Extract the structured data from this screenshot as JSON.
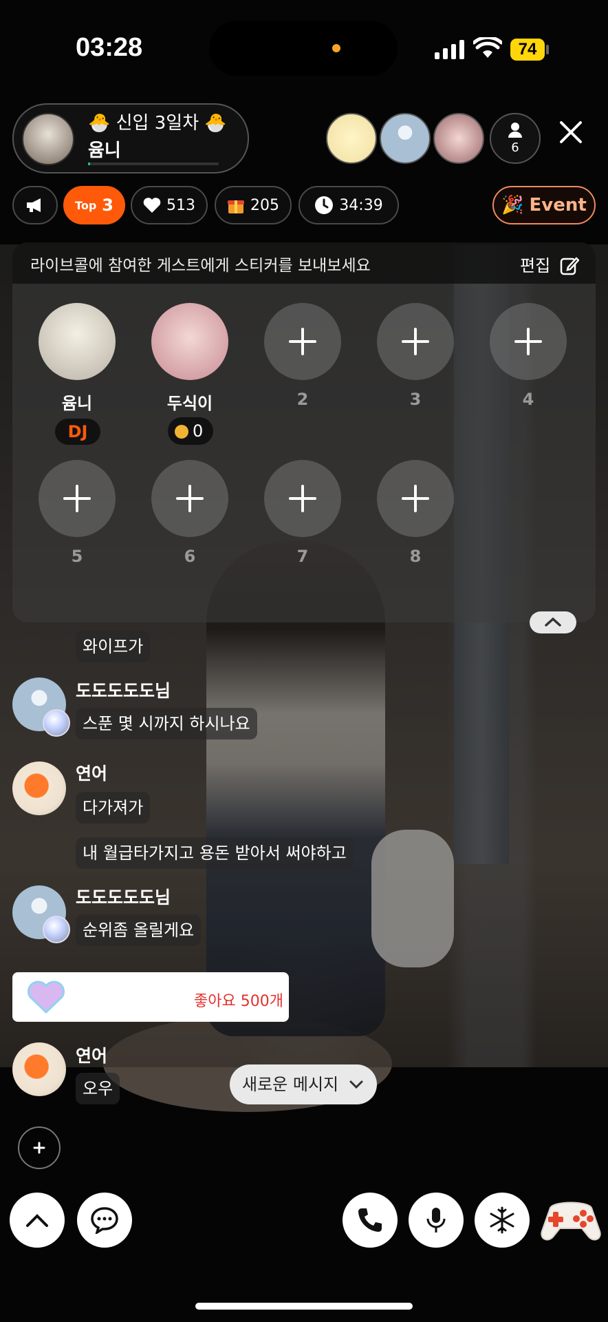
{
  "status_bar": {
    "time": "03:28",
    "battery": "74"
  },
  "host": {
    "title": "신입 3일차",
    "name": "윰니"
  },
  "viewers": {
    "count": "6"
  },
  "chips": {
    "top_label": "Top",
    "top_rank": "3",
    "likes": "513",
    "gifts": "205",
    "timer": "34:39",
    "event": "Event"
  },
  "guest_panel": {
    "message": "라이브콜에 참여한 게스트에게 스티커를 보내보세요",
    "edit": "편집",
    "host_name": "윰니",
    "host_badge": "DJ",
    "guest_name": "두식이",
    "guest_coins": "0",
    "slots": [
      "2",
      "3",
      "4",
      "5",
      "6",
      "7",
      "8"
    ]
  },
  "chat": [
    {
      "user": "",
      "messages": [
        "와이프가"
      ]
    },
    {
      "user": "도도도도도님",
      "messages": [
        "스푼 몇 시까지 하시나요"
      ]
    },
    {
      "user": "연어",
      "messages": [
        "다가져가",
        "내 월급타가지고 용돈 받아서 써야하고"
      ]
    },
    {
      "user": "도도도도도님",
      "messages": [
        "순위좀 올릴게요"
      ]
    },
    {
      "user": "연어",
      "messages": [
        "오우"
      ]
    }
  ],
  "like_notice": {
    "user": "도도도도도님",
    "text": "좋아요 500개"
  },
  "new_message_button": "새로운 메시지",
  "colors": {
    "accent": "#ff5a0a",
    "event": "#f08a60",
    "like_red": "#e3312d",
    "battery": "#ffd60a"
  },
  "icons": [
    "megaphone-icon",
    "heart-icon",
    "gift-icon",
    "clock-icon",
    "party-popper-icon",
    "edit-icon",
    "close-icon",
    "person-icon",
    "plus-icon",
    "chevron-up-icon",
    "chevron-down-icon",
    "chat-icon",
    "phone-icon",
    "mic-icon",
    "snowflake-icon",
    "gamepad-icon"
  ]
}
